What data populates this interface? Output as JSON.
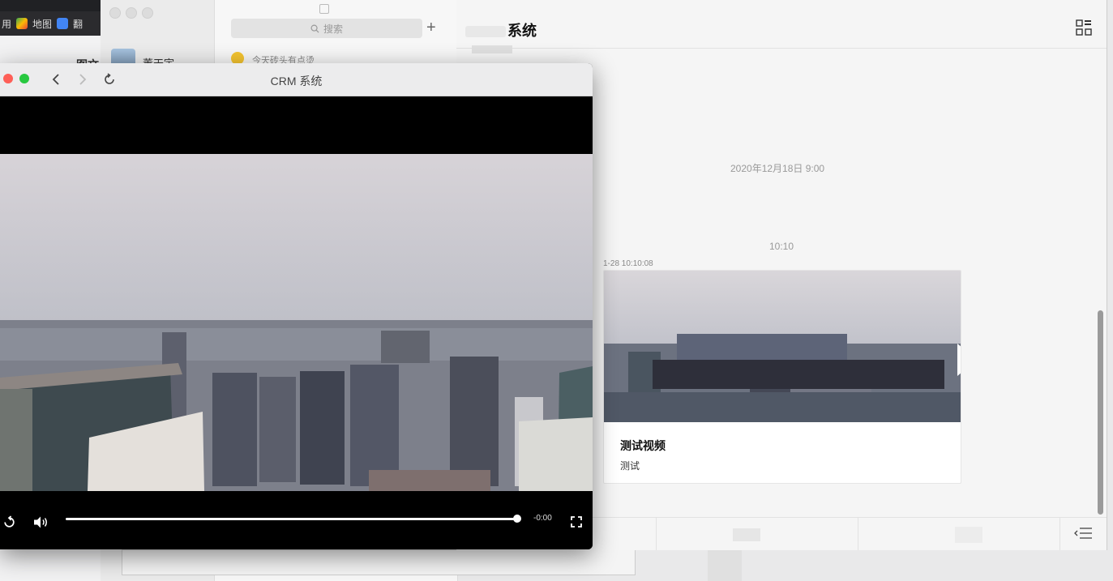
{
  "browser": {
    "bookmarks": [
      {
        "label": "用",
        "icon": "app-icon"
      },
      {
        "label": "地图",
        "icon": "maps-icon"
      },
      {
        "label": "翻",
        "icon": "translate-icon"
      }
    ],
    "bg_heading": "图文"
  },
  "chat_list": {
    "search_placeholder": "搜索",
    "add_symbol": "+",
    "contact_name": "董天宇",
    "preview_text": "今天砖头有点烫"
  },
  "chat": {
    "title": "系统",
    "timestamps": [
      "2020年12月18日 9:00",
      "10:10"
    ],
    "message_time": "1-28 10:10:08",
    "video_card": {
      "title": "测试视频",
      "description": "测试"
    }
  },
  "player": {
    "window_title": "CRM 系统",
    "time_remaining": "-0:00",
    "progress": 1.0
  },
  "colors": {
    "close": "#fe5f57",
    "maximize": "#28c840",
    "player_bg": "#000000"
  }
}
